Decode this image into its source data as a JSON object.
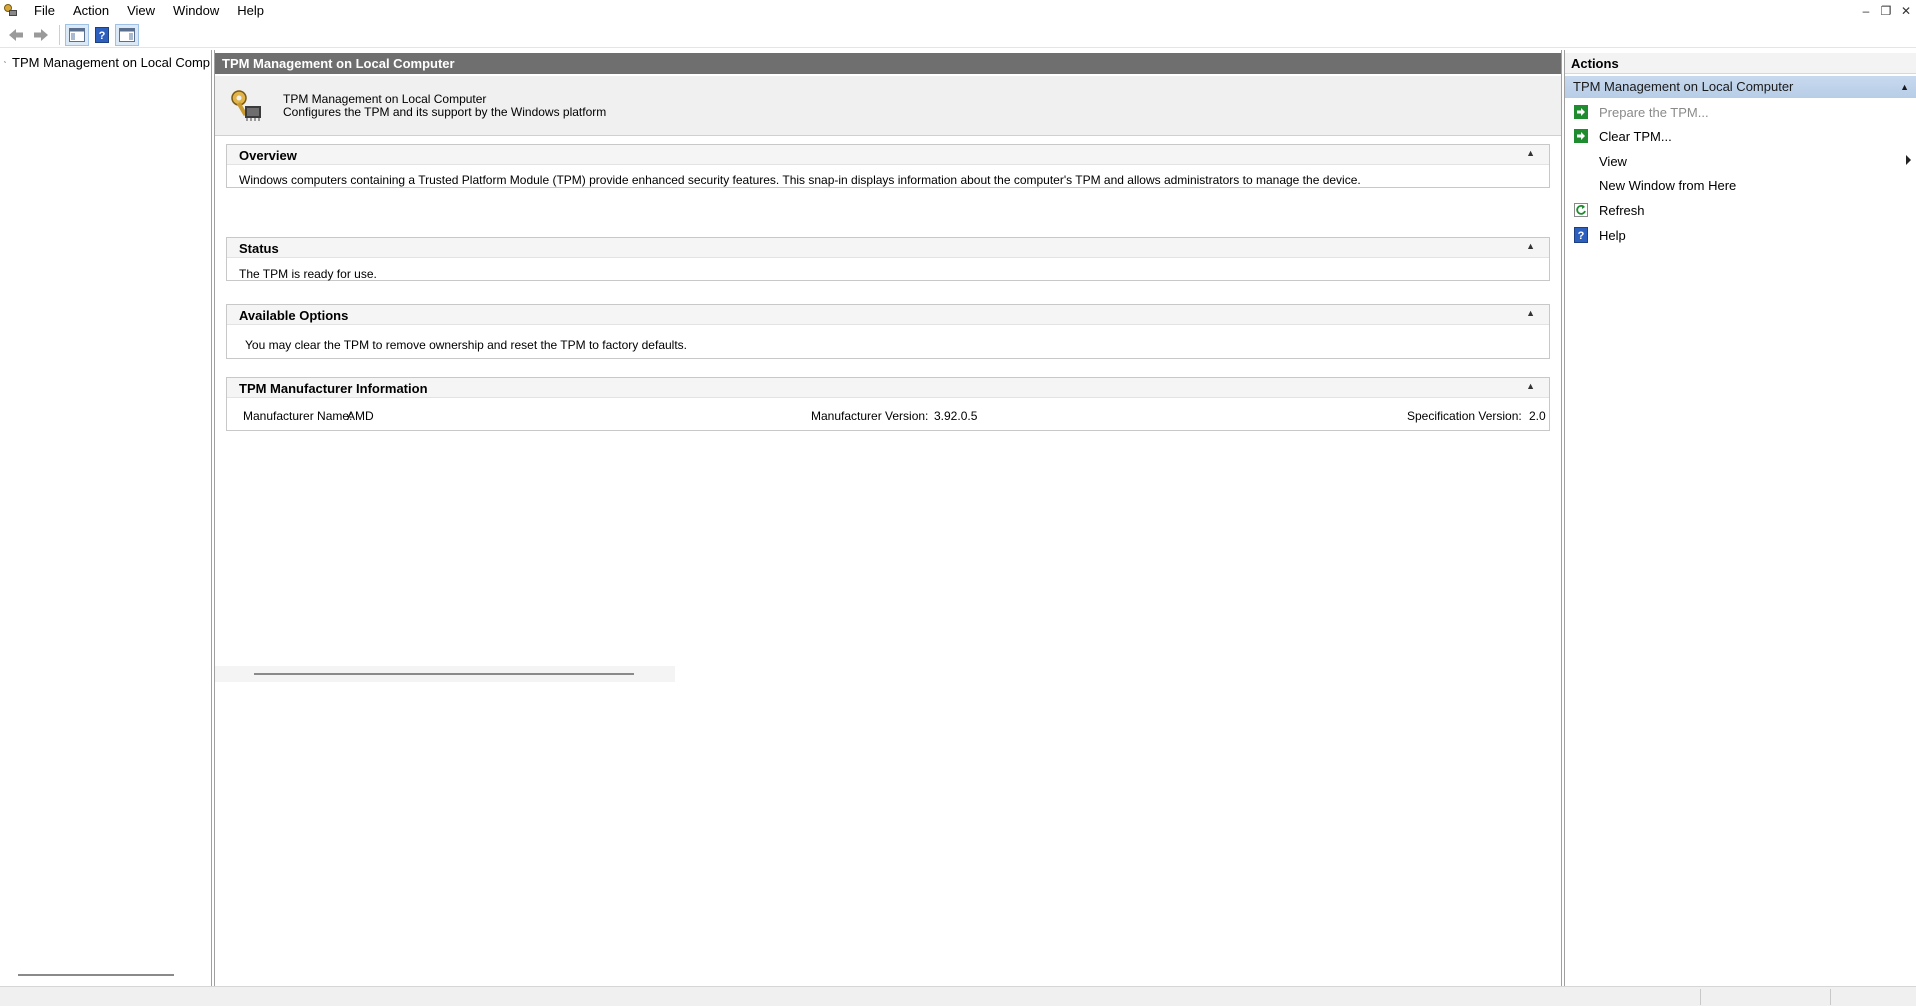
{
  "menubar": {
    "items": [
      "File",
      "Action",
      "View",
      "Window",
      "Help"
    ]
  },
  "window_controls": {
    "minimize": "–",
    "restore": "❐",
    "close": "✕"
  },
  "tree": {
    "root_label": "TPM Management on Local Comp"
  },
  "center": {
    "title": "TPM Management on Local Computer",
    "header": {
      "title": "TPM Management on Local Computer",
      "description": "Configures the TPM and its support by the Windows platform"
    },
    "sections": {
      "overview": {
        "title": "Overview",
        "text": "Windows computers containing a Trusted Platform Module (TPM) provide enhanced security features. This snap-in displays information about the computer's TPM and allows administrators to manage the device."
      },
      "status": {
        "title": "Status",
        "text": "The TPM is ready for use."
      },
      "available_options": {
        "title": "Available Options",
        "text": "You may clear the TPM to remove ownership and reset the TPM to factory defaults."
      },
      "manufacturer": {
        "title": "TPM Manufacturer Information",
        "name_label": "Manufacturer Name:",
        "name_value": "AMD",
        "version_label": "Manufacturer Version:",
        "version_value": "3.92.0.5",
        "spec_label": "Specification Version:",
        "spec_value": "2.0"
      }
    }
  },
  "actions": {
    "title": "Actions",
    "group_title": "TPM Management on Local Computer",
    "items": [
      {
        "label": "Prepare the TPM...",
        "icon": "green-arrow-icon",
        "enabled": false
      },
      {
        "label": "Clear TPM...",
        "icon": "green-arrow-icon",
        "enabled": true
      },
      {
        "label": "View",
        "icon": "",
        "enabled": true,
        "submenu": true
      },
      {
        "label": "New Window from Here",
        "icon": "",
        "enabled": true
      },
      {
        "label": "Refresh",
        "icon": "refresh-icon",
        "enabled": true
      },
      {
        "label": "Help",
        "icon": "help-icon",
        "enabled": true
      }
    ]
  },
  "colors": {
    "center_titlebar": "#6f6f6f",
    "action_group": "#c7d9ee",
    "action_icon_green": "#1e8c2f",
    "help_icon_blue": "#2d5fbf"
  }
}
